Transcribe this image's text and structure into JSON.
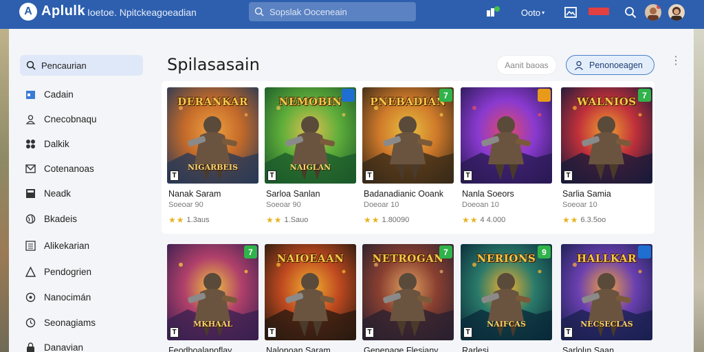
{
  "topbar": {
    "logo_letter": "A",
    "app_name": "Aplulk",
    "subtitle": "Ioetoe. Npitckeagoeadian",
    "search_placeholder": "Sopslak Ooceneain",
    "right_label": "Ooto",
    "flag_text": "",
    "colors": {
      "bar": "#2d5fae",
      "search": "#5b82c2"
    }
  },
  "sidebar": {
    "search_label": "Pencaurian",
    "items": [
      {
        "label": "Cadain",
        "icon": "calendar-icon"
      },
      {
        "label": "Cnecobnaqu",
        "icon": "user-icon"
      },
      {
        "label": "Dalkik",
        "icon": "gamepad-icon"
      },
      {
        "label": "Cotenanoas",
        "icon": "envelope-icon"
      },
      {
        "label": "Neadk",
        "icon": "news-icon"
      },
      {
        "label": "Bkadeis",
        "icon": "globe-icon"
      },
      {
        "label": "Alikekarian",
        "icon": "list-icon"
      },
      {
        "label": "Pendogrien",
        "icon": "triangle-icon"
      },
      {
        "label": "Nanocimán",
        "icon": "radio-icon"
      },
      {
        "label": "Seonagiams",
        "icon": "clock-icon"
      },
      {
        "label": "Danavian",
        "icon": "lock-icon"
      }
    ]
  },
  "main": {
    "title": "Spilasasain",
    "btn_plain": "Aanit baoas",
    "btn_outline": "Penonoeagen",
    "cards_row1": [
      {
        "thumb_title": "DERANKAR",
        "thumb_sub": "NIGARBEIS",
        "badge": "",
        "badge_color": "",
        "name": "Nanak Saram",
        "category": "Soeoar 90",
        "stars": "★★",
        "rating": "1.3aus",
        "palette": [
          "#2a3a55",
          "#c46a2a",
          "#f0a040"
        ]
      },
      {
        "thumb_title": "NEMOBIN",
        "thumb_sub": "NAIGLAN",
        "badge": "",
        "badge_color": "#1e6fd0",
        "name": "Sarloa Sanlan",
        "category": "Soeoar 90",
        "stars": "★★",
        "rating": "1.Sauo",
        "palette": [
          "#1c5a2a",
          "#5fae3a",
          "#e0c050"
        ]
      },
      {
        "thumb_title": "PNEBADIAN",
        "thumb_sub": "",
        "badge": "7",
        "badge_color": "#2fb34a",
        "name": "Badanadianic Ooank",
        "category": "Doeoar 10",
        "stars": "★★",
        "rating": "1.80090",
        "palette": [
          "#3a2a18",
          "#d07a2a",
          "#e8c040"
        ]
      },
      {
        "thumb_title": "",
        "thumb_sub": "",
        "badge": "",
        "badge_color": "#e89a1a",
        "name": "Nanla Soeors",
        "category": "Doeoan 10",
        "stars": "★★",
        "rating": "4 4.000",
        "palette": [
          "#2a1a55",
          "#8a3ad0",
          "#e04a6a"
        ]
      },
      {
        "thumb_title": "WALNIOS",
        "thumb_sub": "",
        "badge": "7",
        "badge_color": "#2fb34a",
        "name": "Sarlia Samia",
        "category": "Soeoar 10",
        "stars": "★★",
        "rating": "6.3.5oo",
        "palette": [
          "#1a1a3a",
          "#c0303a",
          "#f0a030"
        ]
      }
    ],
    "cards_row2": [
      {
        "thumb_title": "",
        "thumb_sub": "MKHAAL",
        "badge": "7",
        "badge_color": "#2fb34a",
        "name": "Feodboalanoflay",
        "category": "",
        "palette": [
          "#3a2050",
          "#b0406a",
          "#f0c040"
        ]
      },
      {
        "thumb_title": "NAIOEAAN",
        "thumb_sub": "",
        "badge": "",
        "badge_color": "",
        "name": "Nalonoan Saram",
        "category": "",
        "palette": [
          "#2a1a10",
          "#c04a20",
          "#f0b030"
        ]
      },
      {
        "thumb_title": "NETROGAN",
        "thumb_sub": "",
        "badge": "7",
        "badge_color": "#2fb34a",
        "name": "Genenage Flesiany",
        "category": "",
        "palette": [
          "#2a2030",
          "#8a4030",
          "#e0a060"
        ]
      },
      {
        "thumb_title": "NERIONS",
        "thumb_sub": "NAIFCAS",
        "badge": "9",
        "badge_color": "#2fb34a",
        "name": "Rarlesi",
        "category": "",
        "palette": [
          "#0a2a3a",
          "#2a7a6a",
          "#f0b030"
        ]
      },
      {
        "thumb_title": "HALLKAR",
        "thumb_sub": "NECSECLAS",
        "badge": "",
        "badge_color": "#1e6fd0",
        "name": "Sarlolın Saan",
        "category": "",
        "palette": [
          "#1a2050",
          "#6a40b0",
          "#f0a040"
        ]
      }
    ]
  }
}
